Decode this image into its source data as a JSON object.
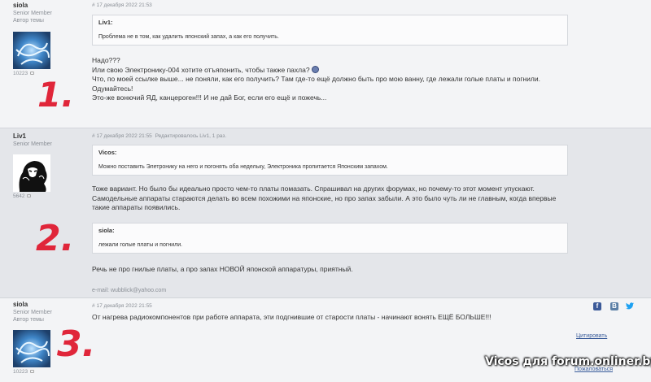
{
  "posts": [
    {
      "author": "siola",
      "rank": "Senior Member",
      "role": "Автор темы",
      "post_count": "10223",
      "timestamp": "17 декабря 2022 21:53",
      "quote": {
        "author": "Liv1:",
        "text": "Проблема не в том, как удалить японский запах, а как его получить."
      },
      "lines": [
        "Надо???",
        "Или свою Электронику-004 хотите отъяпонить, чтобы также пахла?",
        "Что, по моей ссылке выше... не поняли, как его получить? Там где-то ещё должно быть про мою ванну, где лежали голые платы и погнили.",
        "Одумайтесь!",
        "Это-же вонючий ЯД, канцероген!!! И не дай Бог, если его ещё и пожечь..."
      ]
    },
    {
      "author": "Liv1",
      "rank": "Senior Member",
      "post_count": "5642",
      "timestamp": "17 декабря 2022 21:55",
      "edited_prefix": "Редактировалось",
      "edited_by": "Liv1",
      "edited_suffix": ", 1 раз.",
      "quote": {
        "author": "Vicos:",
        "text": "Можно поставить Элетронику на него и погонять оба недельку, Электроника пропитается Японским запахом."
      },
      "lines": [
        "Тоже вариант. Но было бы идеально просто чем-то платы помазать. Спрашивал на других форумах, но почему-то этот момент упускают.",
        "Самодельные аппараты стараются делать во всем похожими на японские, но про запах забыли. А это было чуть ли не главным, когда впервые",
        "такие аппараты появились."
      ],
      "quote2": {
        "author": "siola:",
        "text": "лежали голые платы и погнили."
      },
      "line_after": "Речь не про гнилые платы, а про запах НОВОЙ японской аппаратуры, приятный.",
      "email_label": "e-mail:",
      "email": "wubblick@yahoo.com"
    },
    {
      "author": "siola",
      "rank": "Senior Member",
      "role": "Автор темы",
      "post_count": "10223",
      "timestamp": "17 декабря 2022 21:55",
      "lines": [
        "От нагрева радиокомпонентов при работе аппарата, эти подгнившие от старости платы - начинают вонять ЕЩЁ БОЛЬШЕ!!!"
      ],
      "cite_link": "Цитировать",
      "report_link": "Пожаловаться"
    }
  ],
  "social": {
    "fb": "f",
    "vk": "В",
    "tw": "🐦"
  },
  "marks": [
    "1.",
    "2.",
    "3."
  ],
  "watermark": "Vicos для forum.onliner.by",
  "colors": {
    "accent_red": "#e0263a",
    "link": "#3a5c9a"
  }
}
